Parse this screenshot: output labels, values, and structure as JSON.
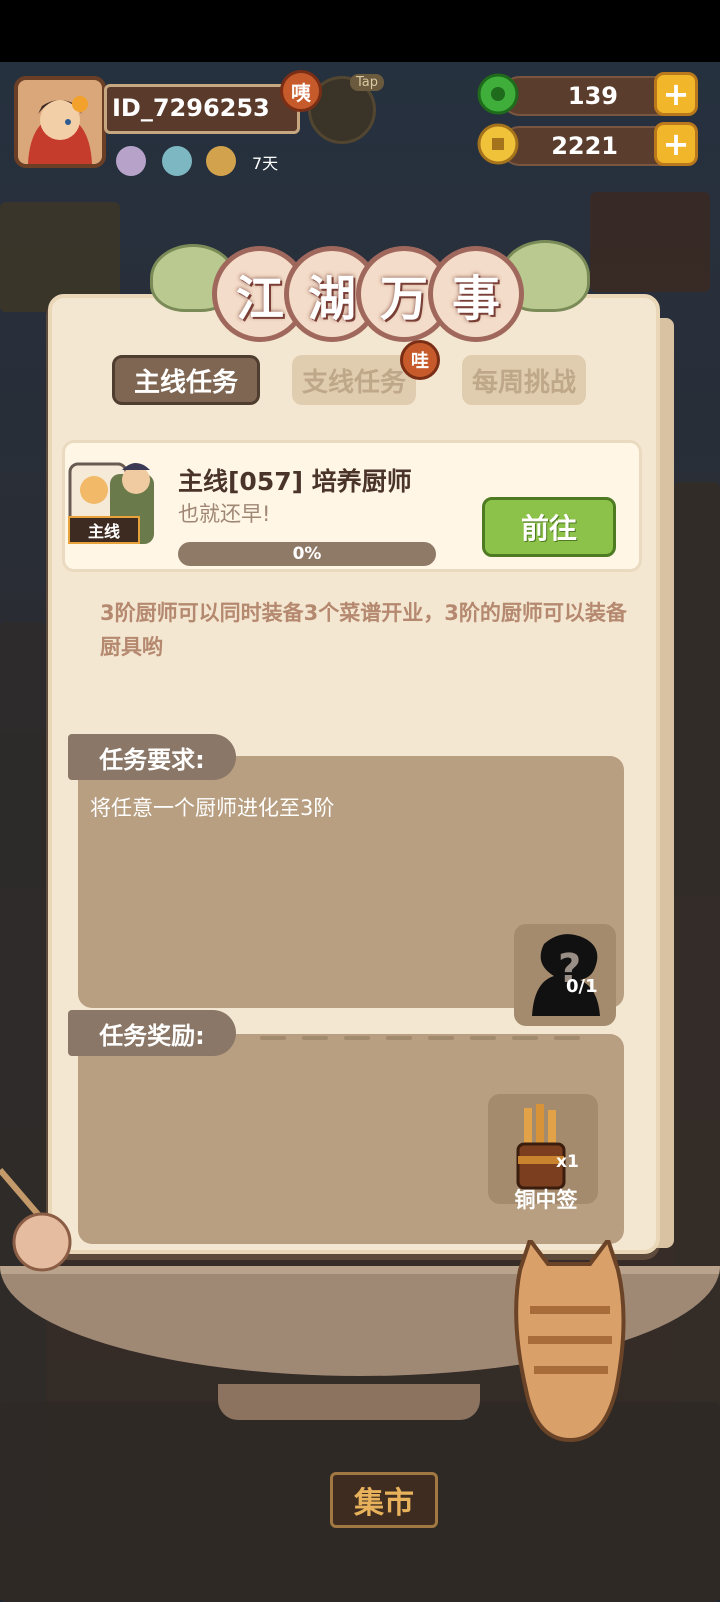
{
  "player": {
    "id": "ID_7296253",
    "badge": "咦",
    "tap_label": "Tap",
    "buff_days": "7天"
  },
  "currency": {
    "jade": {
      "icon": "green-jade-icon",
      "value": "139"
    },
    "coins": {
      "icon": "copper-coin-icon",
      "value": "2221"
    }
  },
  "panel": {
    "title_chars": [
      "江",
      "湖",
      "万",
      "事"
    ],
    "tabs": {
      "main": "主线任务",
      "side": "支线任务",
      "weekly": "每周挑战"
    },
    "side_badge": "哇"
  },
  "quest": {
    "tag": "主线",
    "title": "主线[057] 培养厨师",
    "subtitle": "也就还早!",
    "progress_label": "0%",
    "progress": 0,
    "goto_label": "前往",
    "description": "3阶厨师可以同时装备3个菜谱开业，3阶的厨师可以装备厨具哟"
  },
  "requirement": {
    "header": "任务要求:",
    "text": "将任意一个厨师进化至3阶",
    "slot_count": "0/1"
  },
  "reward": {
    "header": "任务奖励:",
    "item_count": "x1",
    "item_name": "铜中签"
  },
  "bottom": {
    "market_label": "集市"
  }
}
